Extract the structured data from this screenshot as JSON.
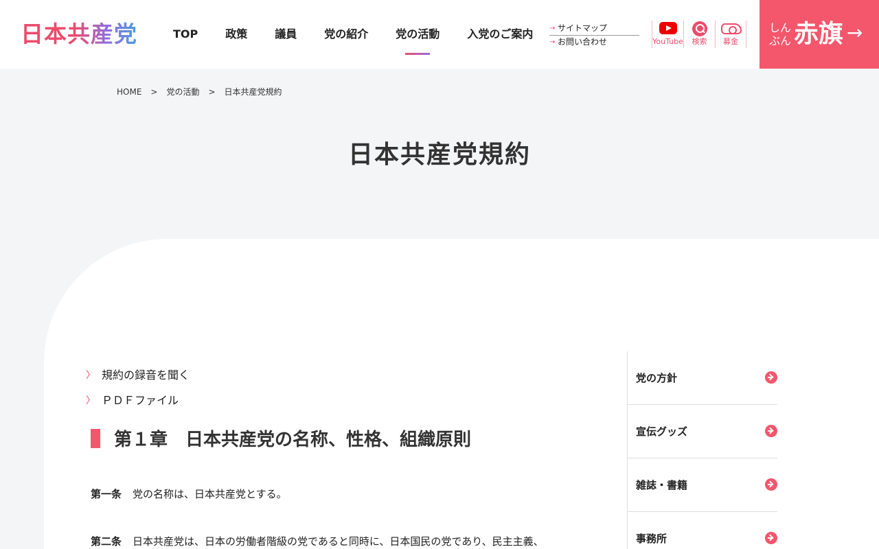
{
  "header": {
    "logo": "日本共産党",
    "nav": [
      {
        "label": "TOP"
      },
      {
        "label": "政策"
      },
      {
        "label": "議員"
      },
      {
        "label": "党の紹介"
      },
      {
        "label": "党の活動"
      },
      {
        "label": "入党のご案内"
      }
    ],
    "active_nav": "党の活動",
    "sublinks": [
      "サイトマップ",
      "お問い合わせ"
    ],
    "youtube_label": "YouTube",
    "search_label": "検索",
    "donate_label": "募金",
    "akahata": {
      "small": "しんぶん",
      "big": "赤旗",
      "arrow": "→"
    }
  },
  "breadcrumb": {
    "home": "HOME",
    "sep": ">",
    "parent": "党の活動",
    "current": "日本共産党規約"
  },
  "page_title": "日本共産党規約",
  "links": [
    "規約の録音を聞く",
    "ＰＤＦファイル"
  ],
  "chapter_title": "第１章　日本共産党の名称、性格、組織原則",
  "articles": [
    {
      "label": "第一条",
      "text": "党の名称は、日本共産党とする。"
    },
    {
      "label": "第二条",
      "text": "日本共産党は、日本の労働者階級の党であると同時に、日本国民の党であり、民主主義、"
    }
  ],
  "sidebar": [
    "党の方針",
    "宣伝グッズ",
    "雑誌・書籍",
    "事務所"
  ],
  "colors": {
    "accent": "#f4566b",
    "background": "#f4f5f7"
  },
  "icons": [
    "youtube-icon",
    "search-icon",
    "donate-icon",
    "arrow-right-icon",
    "circle-arrow-icon"
  ]
}
